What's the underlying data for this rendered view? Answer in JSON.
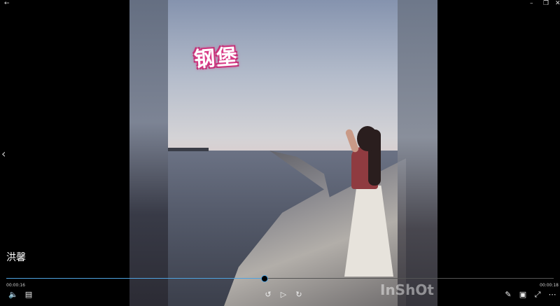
{
  "window": {
    "back_icon": "arrow-left-icon",
    "minimize_icon": "minimize-icon",
    "maximize_icon": "maximize-icon",
    "close_icon": "close-icon"
  },
  "video": {
    "caption": "钢堡",
    "watermark": "InShOt",
    "title": "洪馨"
  },
  "playback": {
    "current_time": "00:00:16",
    "total_time": "00:00:18",
    "progress": 0.47
  },
  "controls": {
    "volume_icon": "volume-icon",
    "subtitles_icon": "subtitles-icon",
    "rewind_icon": "rewind-10-icon",
    "play_icon": "play-icon",
    "forward_icon": "forward-30-icon",
    "edit_icon": "pen-icon",
    "mini_view_icon": "mini-view-icon",
    "fullscreen_icon": "fullscreen-icon",
    "more_icon": "more-icon"
  },
  "colors": {
    "accent": "#4fa3e0",
    "background": "#000000"
  }
}
